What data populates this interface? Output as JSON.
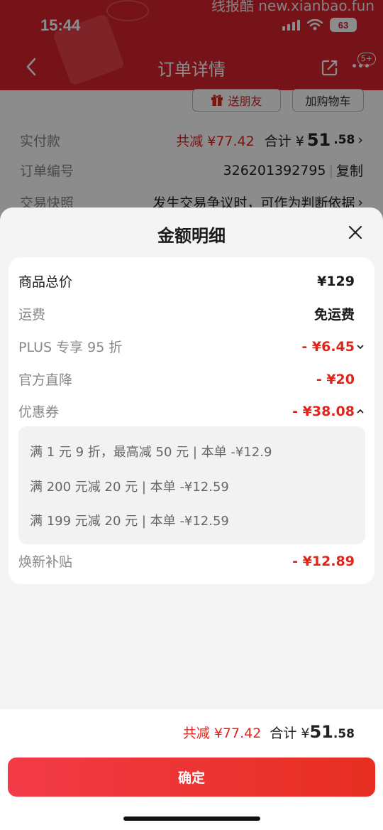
{
  "status_bar": {
    "time": "15:44",
    "battery": "63",
    "watermark": "线报酷 new.xianbao.fun"
  },
  "header": {
    "title": "订单详情",
    "badge": "5+"
  },
  "bg_buttons": {
    "gift": "送朋友",
    "cart": "加购物车"
  },
  "bg_rows": [
    {
      "label": "实付款",
      "discount": "共减 ¥77.42",
      "total_prefix": "合计 ¥",
      "total_int": "51",
      "total_dec": ".58"
    },
    {
      "label": "订单编号",
      "value": "326201392795",
      "action": "复制"
    },
    {
      "label": "交易快照",
      "value": "发生交易争议时，可作为判断依据"
    }
  ],
  "sheet": {
    "title": "金额明细",
    "rows": [
      {
        "label": "商品总价",
        "value": "¥129"
      },
      {
        "label": "运费",
        "value": "免运费"
      },
      {
        "label": "PLUS 专享 95 折",
        "value": "- ¥6.45"
      },
      {
        "label": "官方直降",
        "value": "- ¥20"
      },
      {
        "label": "优惠券",
        "value": "- ¥38.08"
      },
      {
        "label": "焕新补贴",
        "value": "- ¥12.89"
      }
    ],
    "coupons": [
      "满 1 元 9 折，最高减 50 元 | 本单 -¥12.9",
      "满 200 元减 20 元 | 本单 -¥12.59",
      "满 199 元减 20 元 | 本单 -¥12.59"
    ]
  },
  "footer": {
    "discount": "共减 ¥77.42",
    "total_prefix": "合计 ¥",
    "total_int": "51",
    "total_dec": ".58",
    "confirm": "确定"
  },
  "colors": {
    "brand_red": "#e1251b",
    "header_red": "#d6232e"
  }
}
